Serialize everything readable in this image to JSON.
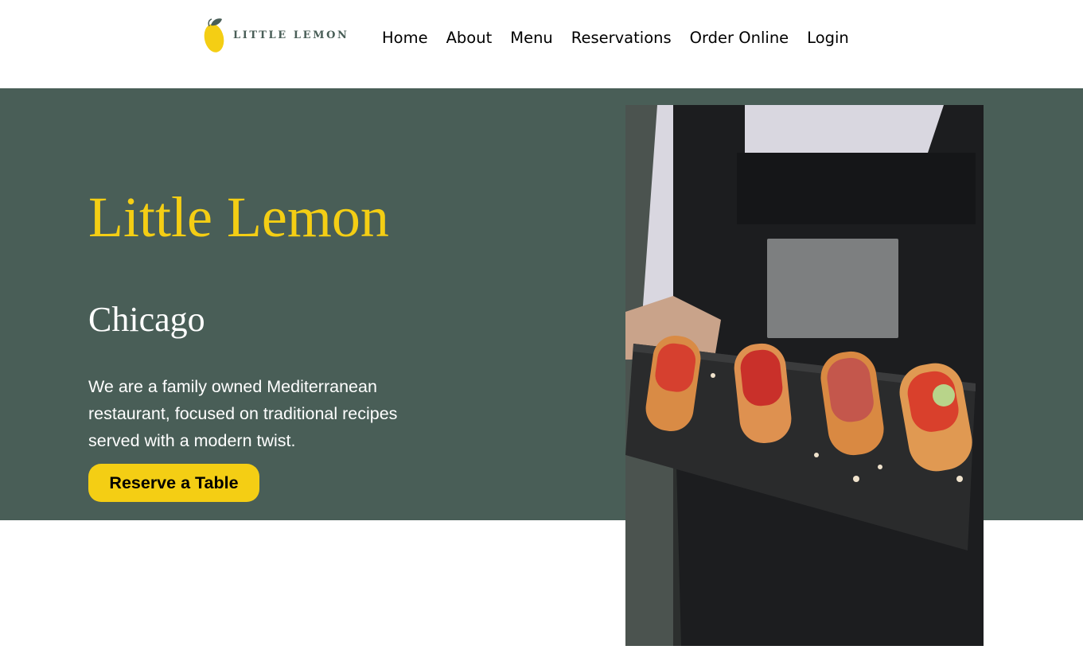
{
  "brand": {
    "logo_text": "LITTLE LEMON",
    "colors": {
      "primary_green": "#495e57",
      "primary_yellow": "#f4ce14",
      "white": "#ffffff",
      "text_dark": "#000000"
    },
    "logo_icon": "lemon-icon"
  },
  "nav": {
    "items": [
      {
        "label": "Home"
      },
      {
        "label": "About"
      },
      {
        "label": "Menu"
      },
      {
        "label": "Reservations"
      },
      {
        "label": "Order Online"
      },
      {
        "label": "Login"
      }
    ]
  },
  "hero": {
    "title": "Little Lemon",
    "subtitle": "Chicago",
    "description": "We are a family owned Mediterranean restaurant, focused on traditional recipes served with a modern twist.",
    "cta_label": "Reserve a Table",
    "image_subject": "chef holding slate platter of bruschetta"
  }
}
